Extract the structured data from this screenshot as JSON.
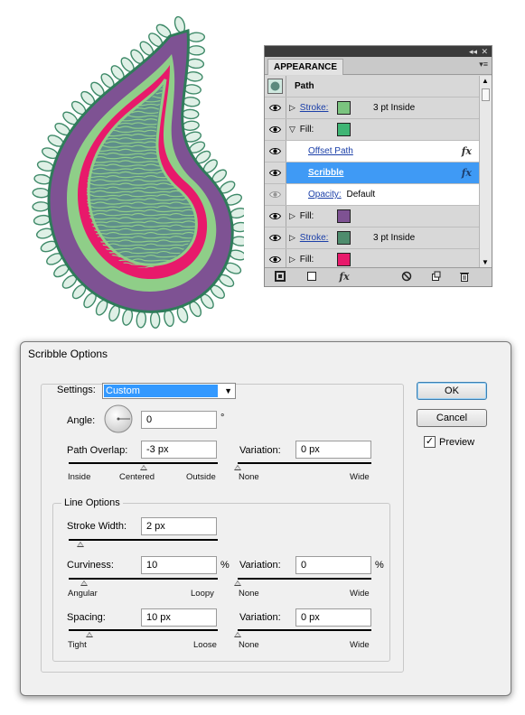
{
  "appearance_panel": {
    "tab_label": "APPEARANCE",
    "collapse_glyph": "◂◂",
    "close_glyph": "✕",
    "menu_glyph": "▾≡",
    "header": "Path",
    "rows": [
      {
        "type": "stroke",
        "label": "Stroke:",
        "swatch_color": "#7bc47f",
        "extra": "3 pt  Inside",
        "expand": "▷"
      },
      {
        "type": "fill",
        "label": "Fill:",
        "swatch_color": "#3fb574",
        "extra": "",
        "expand": "▽"
      },
      {
        "type": "effect",
        "label": "Offset Path",
        "fx": "fx"
      },
      {
        "type": "effect-selected",
        "label": "Scribble",
        "fx": "fx"
      },
      {
        "type": "opacity",
        "label": "Opacity:",
        "extra": "Default"
      },
      {
        "type": "fill",
        "label": "Fill:",
        "swatch_color": "#7e5293",
        "extra": "",
        "expand": "▷"
      },
      {
        "type": "stroke",
        "label": "Stroke:",
        "swatch_color": "#4e8c6d",
        "extra": "3 pt  Inside",
        "expand": "▷"
      },
      {
        "type": "fill",
        "label": "Fill:",
        "swatch_color": "#e8196b",
        "extra": "",
        "expand": "▷"
      }
    ],
    "bottom_icons": [
      "new-stroke-icon",
      "new-fill-icon",
      "add-effect-icon",
      "clear-appearance-icon",
      "duplicate-item-icon",
      "delete-item-icon"
    ],
    "fx_menu_label": "fx"
  },
  "dialog": {
    "title": "Scribble Options",
    "settings_label": "Settings:",
    "settings_value": "Custom",
    "angle_label": "Angle:",
    "angle_value": "0",
    "degree_symbol": "°",
    "path_overlap_label": "Path Overlap:",
    "path_overlap_value": "-3 px",
    "path_overlap_scale": [
      "Inside",
      "Centered",
      "Outside"
    ],
    "path_overlap_position": 0.5,
    "variation1_label": "Variation:",
    "variation1_value": "0 px",
    "variation1_scale": [
      "None",
      "Wide"
    ],
    "variation1_position": 0,
    "line_options_label": "Line Options",
    "stroke_width_label": "Stroke Width:",
    "stroke_width_value": "2 px",
    "stroke_width_position": 0.08,
    "curviness_label": "Curviness:",
    "curviness_value": "10",
    "curviness_unit": "%",
    "curviness_scale": [
      "Angular",
      "Loopy"
    ],
    "curviness_position": 0.1,
    "variation2_label": "Variation:",
    "variation2_value": "0",
    "variation2_unit": "%",
    "variation2_scale": [
      "None",
      "Wide"
    ],
    "variation2_position": 0,
    "spacing_label": "Spacing:",
    "spacing_value": "10 px",
    "spacing_scale": [
      "Tight",
      "Loose"
    ],
    "spacing_position": 0.14,
    "variation3_label": "Variation:",
    "variation3_value": "0 px",
    "variation3_scale": [
      "None",
      "Wide"
    ],
    "variation3_position": 0,
    "ok_label": "OK",
    "cancel_label": "Cancel",
    "preview_label": "Preview",
    "preview_checked": true,
    "check_glyph": "✓"
  },
  "colors": {
    "paisley_magenta": "#e8196b",
    "paisley_purple": "#7e5293",
    "paisley_green_light": "#8fce88",
    "paisley_green_dark": "#4e9a76",
    "selection_blue": "#3f9af5"
  }
}
